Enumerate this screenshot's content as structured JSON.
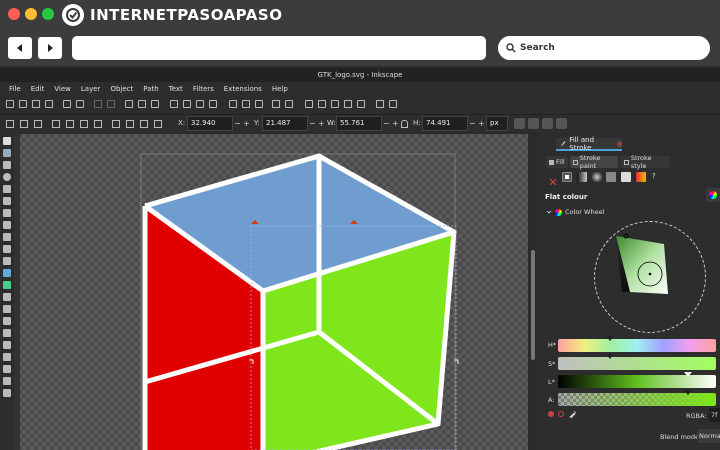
{
  "browser": {
    "logo_text": "INTERNETPASOAPASO",
    "search_label": "Search",
    "url": ""
  },
  "app": {
    "window_title": "GTK_logo.svg - Inkscape",
    "menu": [
      "File",
      "Edit",
      "View",
      "Layer",
      "Object",
      "Path",
      "Text",
      "Filters",
      "Extensions",
      "Help"
    ]
  },
  "toolbar": {
    "x_label": "X:",
    "x_value": "32.940",
    "y_label": "Y:",
    "y_value": "21.487",
    "w_label": "W:",
    "w_value": "55.761",
    "h_label": "H:",
    "h_value": "74.491",
    "unit": "px",
    "minus": "−",
    "plus": "+"
  },
  "panel": {
    "tab_label": "Fill and Stroke",
    "tab_fill": "Fill",
    "tab_stroke_paint": "Stroke paint",
    "tab_stroke_style": "Stroke style",
    "flat_colour": "Flat colour",
    "color_wheel": "Color Wheel",
    "h_label": "H*",
    "s_label": "S*",
    "l_label": "L*",
    "a_label": "A:",
    "rgba_label": "RGBA:",
    "rgba_value": "7f",
    "blend_label": "Blend mode:",
    "blend_value": "Normal",
    "unknown_btn": "?"
  },
  "colors": {
    "cube_top": "#6f9dd0",
    "cube_left": "#e00000",
    "cube_right": "#7ee61a",
    "accent": "#4aa3df"
  },
  "icons": [
    "back-arrow-icon",
    "forward-arrow-icon",
    "search-icon",
    "close-icon"
  ]
}
